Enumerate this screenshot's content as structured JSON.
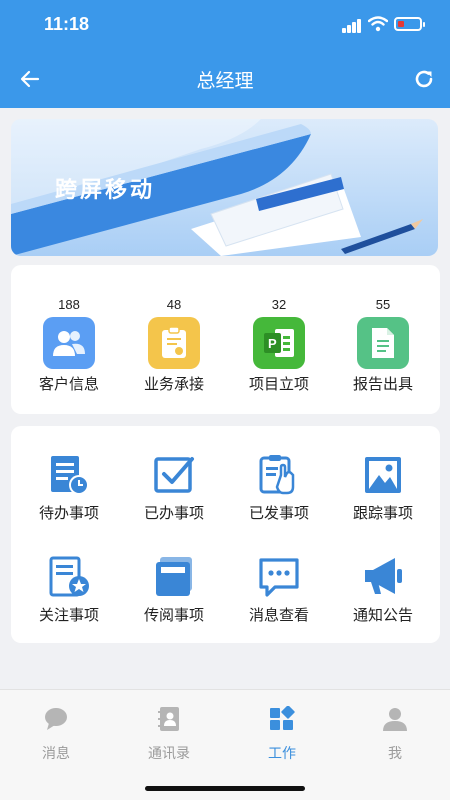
{
  "status": {
    "time": "11:18"
  },
  "header": {
    "title": "总经理",
    "back_icon": "arrow-left-icon",
    "refresh_icon": "refresh-icon"
  },
  "banner": {
    "text": "跨屏移动"
  },
  "stats": [
    {
      "count": "188",
      "label": "客户信息",
      "icon": "customers-icon",
      "color": "#5b9ef3"
    },
    {
      "count": "48",
      "label": "业务承接",
      "icon": "clipboard-icon",
      "color": "#f4c54b"
    },
    {
      "count": "32",
      "label": "项目立项",
      "icon": "project-icon",
      "color": "#45b83a"
    },
    {
      "count": "55",
      "label": "报告出具",
      "icon": "report-icon",
      "color": "#55c286"
    }
  ],
  "tasks": [
    {
      "label": "待办事项",
      "icon": "todo-icon"
    },
    {
      "label": "已办事项",
      "icon": "done-icon"
    },
    {
      "label": "已发事项",
      "icon": "sent-icon"
    },
    {
      "label": "跟踪事项",
      "icon": "track-icon"
    },
    {
      "label": "关注事项",
      "icon": "follow-icon"
    },
    {
      "label": "传阅事项",
      "icon": "circulate-icon"
    },
    {
      "label": "消息查看",
      "icon": "message-icon"
    },
    {
      "label": "通知公告",
      "icon": "announce-icon"
    }
  ],
  "tabs": [
    {
      "label": "消息",
      "icon": "chat-icon",
      "active": false
    },
    {
      "label": "通讯录",
      "icon": "contacts-icon",
      "active": false
    },
    {
      "label": "工作",
      "icon": "work-icon",
      "active": true
    },
    {
      "label": "我",
      "icon": "person-icon",
      "active": false
    }
  ],
  "colors": {
    "primary": "#3b98ea",
    "icon_blue": "#3a86d6",
    "tab_active": "#3b8fdd"
  }
}
